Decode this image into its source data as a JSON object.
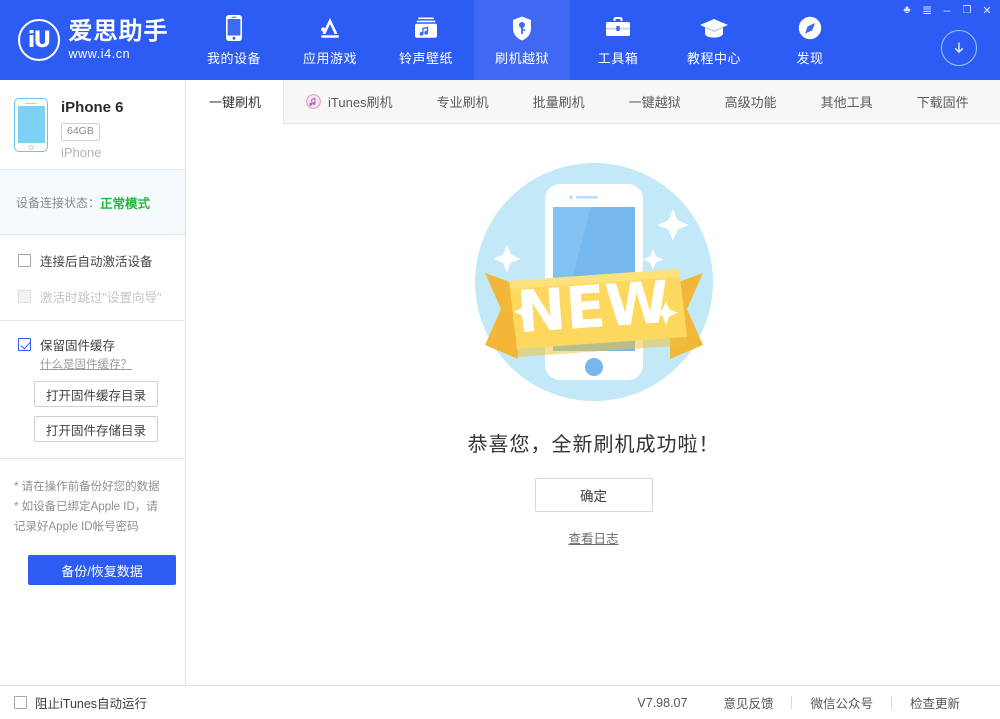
{
  "brand": {
    "logo_mark": "iU",
    "title": "爱思助手",
    "subtitle": "www.i4.cn",
    "accent": "#2d5cf5",
    "accent_active": "#3f69f2"
  },
  "window_controls": [
    {
      "name": "skin-icon",
      "glyph": "♣"
    },
    {
      "name": "menu-icon",
      "glyph": "≣"
    },
    {
      "name": "minimize-icon",
      "glyph": "–"
    },
    {
      "name": "maximize-icon",
      "glyph": "❐"
    },
    {
      "name": "close-icon",
      "glyph": "✕"
    }
  ],
  "nav": {
    "items": [
      {
        "label": "我的设备",
        "icon": "phone-icon",
        "active": false
      },
      {
        "label": "应用游戏",
        "icon": "appstore-icon",
        "active": false
      },
      {
        "label": "铃声壁纸",
        "icon": "music-icon",
        "active": false
      },
      {
        "label": "刷机越狱",
        "icon": "jailbreak-shield-icon",
        "active": true
      },
      {
        "label": "工具箱",
        "icon": "toolbox-icon",
        "active": false
      },
      {
        "label": "教程中心",
        "icon": "graduation-cap-icon",
        "active": false
      },
      {
        "label": "发现",
        "icon": "compass-icon",
        "active": false
      }
    ],
    "download_icon": "download-circle-icon"
  },
  "sidebar": {
    "device": {
      "name": "iPhone 6",
      "capacity": "64GB",
      "type": "iPhone",
      "thumb_icon": "iphone-thumbnail-icon"
    },
    "connection": {
      "label": "设备连接状态：",
      "value": "正常模式",
      "value_color": "#22bb33"
    },
    "options": [
      {
        "label": "连接后自动激活设备",
        "checked": false,
        "disabled": false
      },
      {
        "label": "激活时跳过\"设置向导\"",
        "checked": false,
        "disabled": true
      }
    ],
    "cache": {
      "checkbox_label": "保留固件缓存",
      "checked": true,
      "help_link": "什么是固件缓存？",
      "buttons": [
        "打开固件缓存目录",
        "打开固件存储目录"
      ]
    },
    "notes": [
      "* 请在操作前备份好您的数据",
      "* 如设备已绑定Apple ID，请",
      "   记录好Apple ID帐号密码"
    ],
    "backup_button": "备份/恢复数据"
  },
  "tabs": [
    {
      "label": "一键刷机",
      "active": true,
      "icon": null
    },
    {
      "label": "iTunes刷机",
      "active": false,
      "icon": "itunes-icon"
    },
    {
      "label": "专业刷机",
      "active": false,
      "icon": null
    },
    {
      "label": "批量刷机",
      "active": false,
      "icon": null
    },
    {
      "label": "一键越狱",
      "active": false,
      "icon": null
    },
    {
      "label": "高级功能",
      "active": false,
      "icon": null
    },
    {
      "label": "其他工具",
      "active": false,
      "icon": null
    },
    {
      "label": "下载固件",
      "active": false,
      "icon": null
    }
  ],
  "main": {
    "illustration": "new-phone-ribbon-illustration",
    "ribbon_text": "NEW",
    "headline": "恭喜您，全新刷机成功啦！",
    "confirm_button": "确定",
    "log_link": "查看日志"
  },
  "statusbar": {
    "block_itunes_label": "阻止iTunes自动运行",
    "block_itunes_checked": false,
    "version": "V7.98.07",
    "feedback": "意见反馈",
    "wechat": "微信公众号",
    "check_update": "检查更新"
  }
}
